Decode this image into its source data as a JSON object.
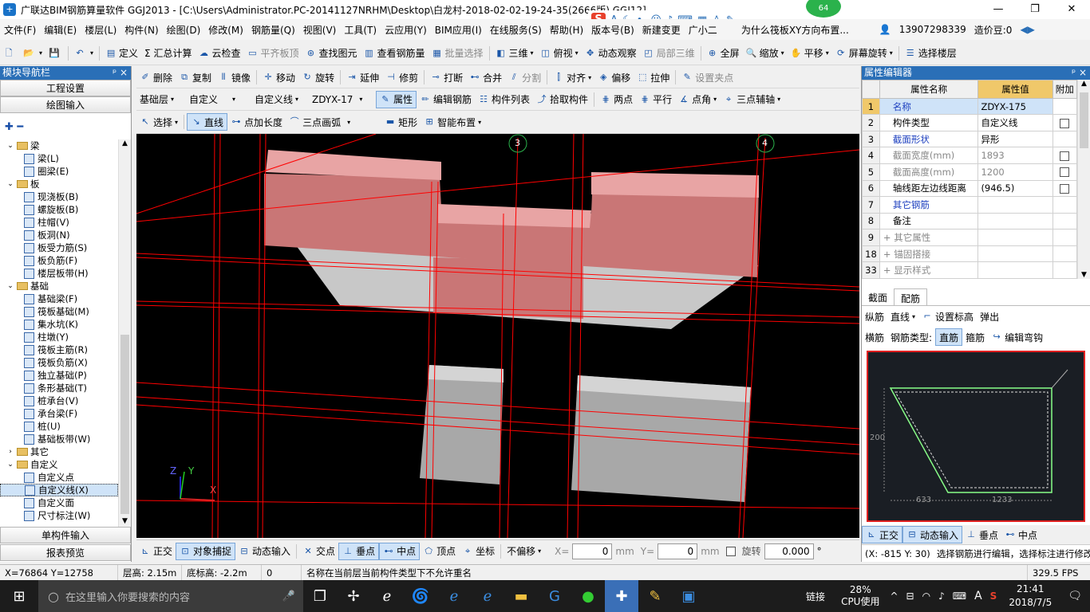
{
  "window": {
    "title": "广联达BIM钢筋算量软件 GGJ2013 - [C:\\Users\\Administrator.PC-20141127NRHM\\Desktop\\白龙村-2018-02-02-19-24-35(2666版).GGJ12]",
    "badge": "64",
    "minimize": "—",
    "maximize": "❐",
    "close": "✕"
  },
  "menu": {
    "items": [
      "文件(F)",
      "编辑(E)",
      "楼层(L)",
      "构件(N)",
      "绘图(D)",
      "修改(M)",
      "钢筋量(Q)",
      "视图(V)",
      "工具(T)",
      "云应用(Y)",
      "BIM应用(I)",
      "在线服务(S)",
      "帮助(H)",
      "版本号(B)"
    ],
    "new_change": "新建变更",
    "xiaoguang": "广小二",
    "question": "为什么筏板XY方向布置...",
    "phone": "13907298339",
    "price_bean": "造价豆:0"
  },
  "toolbar1": [
    "定义",
    "Σ 汇总计算",
    "云检查",
    "平齐板顶",
    "查找图元",
    "查看钢筋量",
    "批量选择",
    "三维",
    "俯视",
    "动态观察",
    "局部三维",
    "全屏",
    "缩放",
    "平移",
    "屏幕旋转",
    "选择楼层"
  ],
  "toolbar2": [
    "删除",
    "复制",
    "镜像",
    "移动",
    "旋转",
    "延伸",
    "修剪",
    "打断",
    "合并",
    "分割",
    "对齐",
    "偏移",
    "拉伸",
    "设置夹点"
  ],
  "toolbar3": {
    "floor": "基础层",
    "category": "自定义",
    "type": "自定义线",
    "component": "ZDYX-17",
    "buttons": [
      "属性",
      "编辑钢筋",
      "构件列表",
      "拾取构件",
      "两点",
      "平行",
      "点角",
      "三点辅轴"
    ]
  },
  "toolbar4": [
    "选择",
    "直线",
    "点加长度",
    "三点画弧",
    "矩形",
    "智能布置"
  ],
  "leftpanel": {
    "title": "模块导航栏",
    "pin": "ᵖ ×",
    "btn_project": "工程设置",
    "btn_draw": "绘图输入",
    "tree": [
      {
        "label": "梁",
        "level": 0,
        "folder": true
      },
      {
        "label": "梁(L)",
        "level": 1
      },
      {
        "label": "圈梁(E)",
        "level": 1
      },
      {
        "label": "板",
        "level": 0,
        "folder": true
      },
      {
        "label": "现浇板(B)",
        "level": 1
      },
      {
        "label": "螺旋板(B)",
        "level": 1
      },
      {
        "label": "柱帽(V)",
        "level": 1
      },
      {
        "label": "板洞(N)",
        "level": 1
      },
      {
        "label": "板受力筋(S)",
        "level": 1
      },
      {
        "label": "板负筋(F)",
        "level": 1
      },
      {
        "label": "楼层板带(H)",
        "level": 1
      },
      {
        "label": "基础",
        "level": 0,
        "folder": true
      },
      {
        "label": "基础梁(F)",
        "level": 1
      },
      {
        "label": "筏板基础(M)",
        "level": 1
      },
      {
        "label": "集水坑(K)",
        "level": 1
      },
      {
        "label": "柱墩(Y)",
        "level": 1
      },
      {
        "label": "筏板主筋(R)",
        "level": 1
      },
      {
        "label": "筏板负筋(X)",
        "level": 1
      },
      {
        "label": "独立基础(P)",
        "level": 1
      },
      {
        "label": "条形基础(T)",
        "level": 1
      },
      {
        "label": "桩承台(V)",
        "level": 1
      },
      {
        "label": "承台梁(F)",
        "level": 1
      },
      {
        "label": "桩(U)",
        "level": 1
      },
      {
        "label": "基础板带(W)",
        "level": 1
      },
      {
        "label": "其它",
        "level": 0,
        "folder": true,
        "collapsed": true
      },
      {
        "label": "自定义",
        "level": 0,
        "folder": true
      },
      {
        "label": "自定义点",
        "level": 1
      },
      {
        "label": "自定义线(X)",
        "level": 1,
        "selected": true
      },
      {
        "label": "自定义面",
        "level": 1
      },
      {
        "label": "尺寸标注(W)",
        "level": 1
      }
    ],
    "btn_single": "单构件输入",
    "btn_report": "报表预览"
  },
  "viewport": {
    "axis1": "3",
    "axis2": "4",
    "axis_z": "Z",
    "axis_y": "Y",
    "axis_x": "X"
  },
  "rightpanel": {
    "title": "属性编辑器",
    "pin": "ᵖ ×",
    "col_name": "属性名称",
    "col_value": "属性值",
    "col_extra": "附加",
    "rows": [
      {
        "num": "1",
        "name": "名称",
        "value": "ZDYX-175",
        "style": "blue",
        "check": false,
        "sel": true
      },
      {
        "num": "2",
        "name": "构件类型",
        "value": "自定义线",
        "style": "",
        "check": true
      },
      {
        "num": "3",
        "name": "截面形状",
        "value": "异形",
        "style": "blue",
        "check": false
      },
      {
        "num": "4",
        "name": "截面宽度(mm)",
        "value": "1893",
        "style": "gray",
        "check": true
      },
      {
        "num": "5",
        "name": "截面高度(mm)",
        "value": "1200",
        "style": "gray",
        "check": true
      },
      {
        "num": "6",
        "name": "轴线距左边线距离",
        "value": "(946.5)",
        "style": "",
        "check": true
      },
      {
        "num": "7",
        "name": "其它钢筋",
        "value": "",
        "style": "blue",
        "check": false
      },
      {
        "num": "8",
        "name": "备注",
        "value": "",
        "style": "",
        "check": false
      },
      {
        "num": "9",
        "name": "+ 其它属性",
        "value": "",
        "style": "gray",
        "check": false
      },
      {
        "num": "18",
        "name": "+ 锚固搭接",
        "value": "",
        "style": "gray",
        "check": false
      },
      {
        "num": "33",
        "name": "+ 显示样式",
        "value": "",
        "style": "gray",
        "check": false
      }
    ],
    "tab_section": "截面",
    "tab_rebar": "配筋",
    "rebar_tb1": [
      "纵筋",
      "直线",
      "设置标高",
      "弹出"
    ],
    "rebar_tb2": [
      "横筋",
      "钢筋类型:",
      "直筋",
      "箍筋",
      "编辑弯钩"
    ],
    "dim_left": "200",
    "dim_bottom1": "633",
    "dim_bottom2": "1233",
    "bottom_btns": [
      "正交",
      "动态输入",
      "垂点",
      "中点"
    ],
    "coord": "(X: -815 Y: 30)",
    "hint": "选择钢筋进行编辑，选择标注进行修改"
  },
  "bottomtb": {
    "items": [
      "正交",
      "对象捕捉",
      "动态输入",
      "交点",
      "垂点",
      "中点",
      "顶点",
      "坐标"
    ],
    "offset": "不偏移",
    "x_label": "X=",
    "x_val": "0",
    "y_label": "Y=",
    "y_val": "0",
    "unit": "mm",
    "rotate": "旋转",
    "rot_val": "0.000",
    "deg": "°"
  },
  "status": {
    "coords": "X=76864 Y=12758",
    "floor_height": "层高: 2.15m",
    "bottom_height": "底标高: -2.2m",
    "zero": "0",
    "message": "名称在当前层当前构件类型下不允许重名",
    "fps": "329.5 FPS"
  },
  "taskbar": {
    "search": "在这里输入你要搜索的内容",
    "link": "链接",
    "cpu_pct": "28%",
    "cpu_label": "CPU使用",
    "lang": "A",
    "time": "21:41",
    "date": "2018/7/5"
  },
  "colors": {
    "slab_top": "#e8a4a4",
    "slab_front": "#c97676",
    "concrete": "#c8c8c8",
    "grid_red": "#ff0000",
    "accent": "#2a6fb7"
  }
}
